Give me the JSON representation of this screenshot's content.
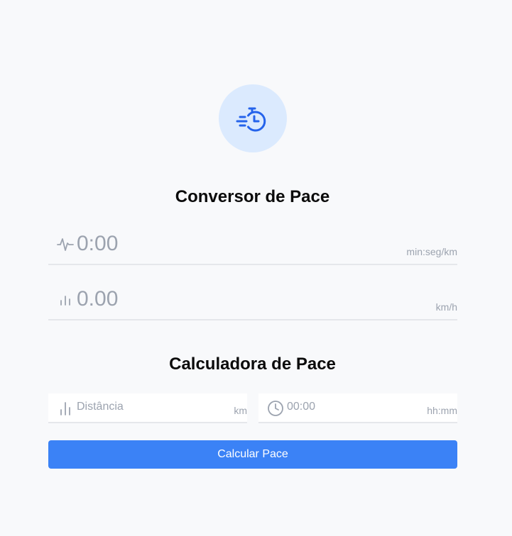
{
  "theme": {
    "accent": "#3b82f6",
    "logo_bg": "#dbeafe",
    "logo_icon": "#2563eb",
    "muted_text": "#9ca3af",
    "heading_text": "#0b0b0b",
    "background": "#f8f9fb"
  },
  "logo": {
    "icon": "fast-stopwatch-icon"
  },
  "converter": {
    "title": "Conversor de Pace",
    "pace": {
      "icon": "pulse-icon",
      "placeholder": "0:00",
      "value": "",
      "unit": "min:seg/km"
    },
    "speed": {
      "icon": "bar-chart-icon",
      "placeholder": "0.00",
      "value": "",
      "unit": "km/h"
    }
  },
  "calculator": {
    "title": "Calculadora de Pace",
    "distance": {
      "icon": "bar-chart-icon",
      "placeholder": "Distância",
      "value": "",
      "unit": "km"
    },
    "time": {
      "icon": "clock-icon",
      "placeholder": "00:00",
      "value": "",
      "unit": "hh:mm"
    },
    "button_label": "Calcular Pace"
  }
}
